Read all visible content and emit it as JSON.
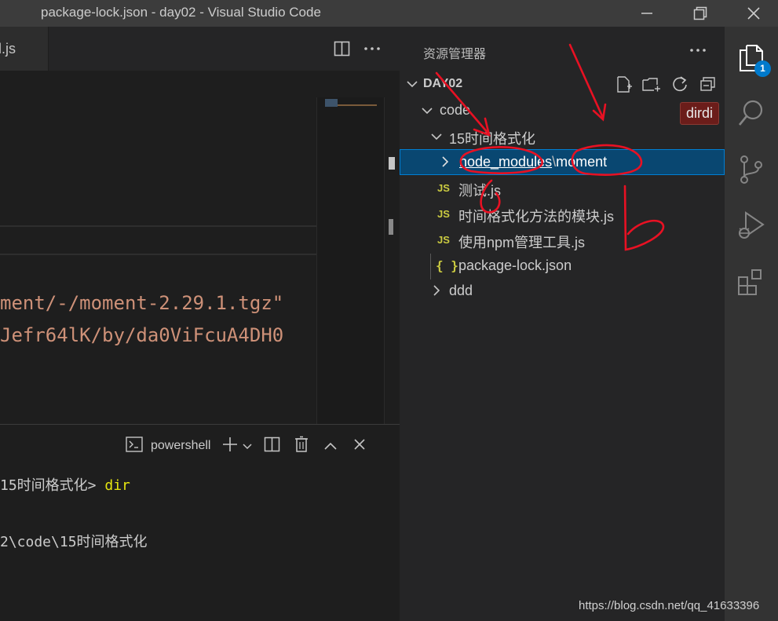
{
  "window": {
    "title": "package-lock.json - day02 - Visual Studio Code"
  },
  "editor": {
    "active_tab_label": "l.js",
    "code_lines": [
      "ment/-/moment-2.29.1.tgz\"",
      "Jefr64lK/by/da0ViFcuA4DH0"
    ]
  },
  "terminal": {
    "shell_label": "powershell",
    "lines": [
      {
        "prefix": "15时间格式化> ",
        "cmd": "dir"
      },
      {
        "prefix": "2\\code\\15时间格式化",
        "cmd": ""
      }
    ]
  },
  "explorer": {
    "title": "资源管理器",
    "workspace": "DAY02",
    "tooltip": "dirdi",
    "tree": [
      {
        "label": "code",
        "kind": "folder-open"
      },
      {
        "label": "15时间格式化",
        "kind": "folder-open"
      },
      {
        "label_a": "node_modules",
        "label_sep": "\\",
        "label_b": "moment",
        "kind": "folder-closed-selected"
      },
      {
        "label": "测试.js",
        "kind": "js"
      },
      {
        "label": "时间格式化方法的模块.js",
        "kind": "js"
      },
      {
        "label": "使用npm管理工具.js",
        "kind": "js"
      },
      {
        "label": "package-lock.json",
        "kind": "json"
      },
      {
        "label": "ddd",
        "kind": "folder-closed"
      }
    ],
    "js_badge": "JS",
    "json_badge": "{ }"
  },
  "activity": {
    "explorer_badge": "1"
  },
  "watermark": "https://blog.csdn.net/qq_41633396",
  "colors": {
    "accent": "#007acc",
    "selection": "#094771",
    "annotation_red": "#e81123"
  }
}
